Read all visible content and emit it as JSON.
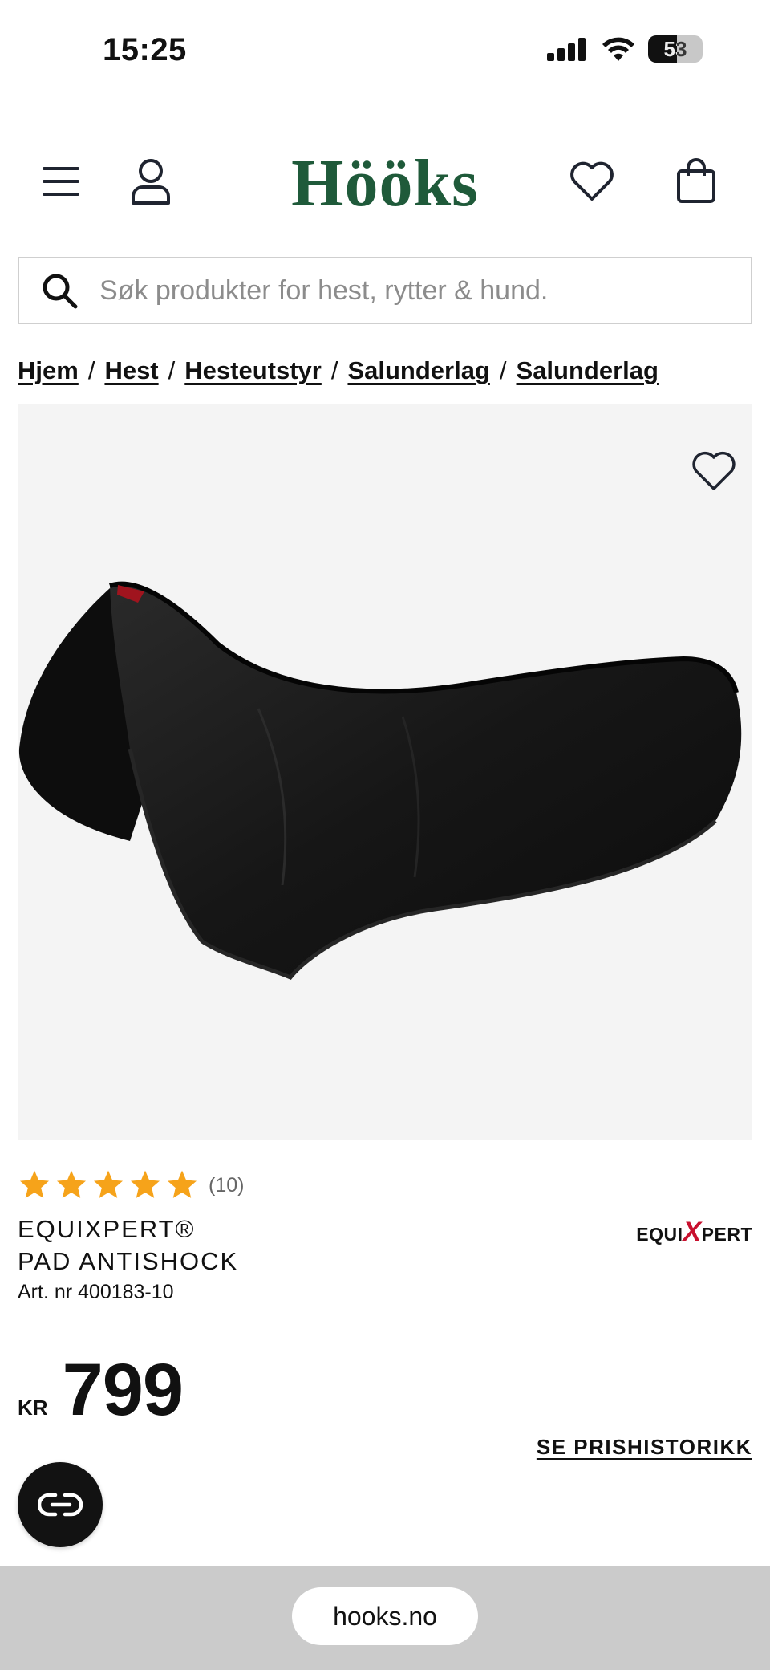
{
  "status_bar": {
    "time": "15:25",
    "battery": "53",
    "battery_level": 0.53
  },
  "header": {
    "logo": "Hööks"
  },
  "search": {
    "placeholder": "Søk produkter for hest, rytter & hund."
  },
  "breadcrumb": [
    "Hjem",
    "Hest",
    "Hesteutstyr",
    "Salunderlag",
    "Salunderlag"
  ],
  "product": {
    "rating": 5,
    "review_count": "(10)",
    "brand": "EQUIXPERT®",
    "name": "PAD ANTISHOCK",
    "art_nr": "Art. nr 400183-10",
    "brand_logo_text": "EQUIXPERT",
    "currency": "KR",
    "price": "799",
    "price_history": "SE PRISHISTORIKK"
  },
  "browser": {
    "url": "hooks.no"
  },
  "colors": {
    "brand_green": "#1f5a3a",
    "star": "#f6a31a",
    "logo_red": "#c8102e"
  }
}
